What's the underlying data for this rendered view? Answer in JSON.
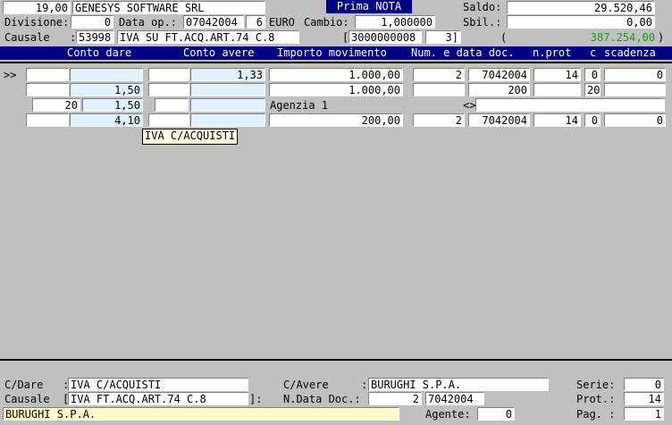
{
  "header": {
    "code": "19,00",
    "company": "GENESYS SOFTWARE SRL",
    "mode_title": "Prima NOTA",
    "saldo_label": "Saldo:",
    "saldo_value": "29.520,46",
    "divisione_label": "Divisione:",
    "divisione_value": "0",
    "data_op_label": "Data op.:",
    "data_op_value": "07042004",
    "weekday_value": "6",
    "currency_label": "EURO",
    "cambio_label": "Cambio:",
    "cambio_value": "1,000000",
    "sbil_label": "Sbil.:",
    "sbil_value": "0,00",
    "causale_label": "Causale",
    "causale_colon": ":",
    "causale_code": "53998",
    "causale_desc": "IVA SU FT.ACQ.ART.74 C.8",
    "ref_open": "[",
    "ref_value": "3000000008",
    "ref_num": "3]",
    "balance_open": "(",
    "balance_value": "387.254,00",
    "balance_close": ")"
  },
  "columns": {
    "conto_dare": "Conto dare",
    "conto_avere": "Conto avere",
    "importo": "Importo movimento",
    "num_data": "Num. e data doc.",
    "nprot": "n.prot",
    "c": "c",
    "scadenza": "scadenza"
  },
  "grid": {
    "cursor": ">>",
    "rows": [
      {
        "c1": "",
        "c2": "",
        "c3": "",
        "c4": "1,33",
        "imp": "1.000,00",
        "num": "2",
        "data": "7042004",
        "prot": "14",
        "c": "0",
        "scad": "0"
      },
      {
        "c1": "",
        "c2": "1,50",
        "c3": "",
        "c4": "",
        "imp": "1.000,00",
        "num": "",
        "data": "200",
        "prot": "",
        "c": "20",
        "scad": ""
      },
      {
        "c1": "20",
        "c2": "1,50",
        "c3": "",
        "c4": "",
        "imp": "Agenzia 1",
        "num": "",
        "data": "<>",
        "prot": "",
        "c": "",
        "scad": ""
      },
      {
        "c1": "",
        "c2": "4,10",
        "c3": "",
        "c4": "",
        "imp": "200,00",
        "num": "2",
        "data": "7042004",
        "prot": "14",
        "c": "0",
        "scad": "0"
      }
    ],
    "tooltip": "IVA C/ACQUISTI"
  },
  "footer": {
    "cdare_label": "C/Dare",
    "cdare_colon": ":",
    "cdare_value": "IVA C/ACQUISTI",
    "cavere_label": "C/Avere",
    "cavere_colon": ":",
    "cavere_value": "BURUGHI S.P.A.",
    "serie_label": "Serie:",
    "serie_value": "0",
    "causale_label": "Causale",
    "causale_open": "[",
    "causale_value": "IVA FT.ACQ.ART.74 C.8",
    "causale_close": "]:",
    "ndata_label": "N.Data Doc.:",
    "ndata_num": "2",
    "ndata_date": "7042004",
    "prot_label": "Prot.:",
    "prot_value": "14",
    "company_value": "BURUGHI S.P.A.",
    "agente_label": "Agente:",
    "agente_value": "0",
    "pag_label": "Pag. :",
    "pag_value": "1"
  },
  "colors": {
    "background": "#c0c0c0",
    "title_bar": "#000080",
    "field_blue": "#e0f0ff",
    "field_yellow": "#ffffc8",
    "balance_green": "#1a9a1a"
  }
}
